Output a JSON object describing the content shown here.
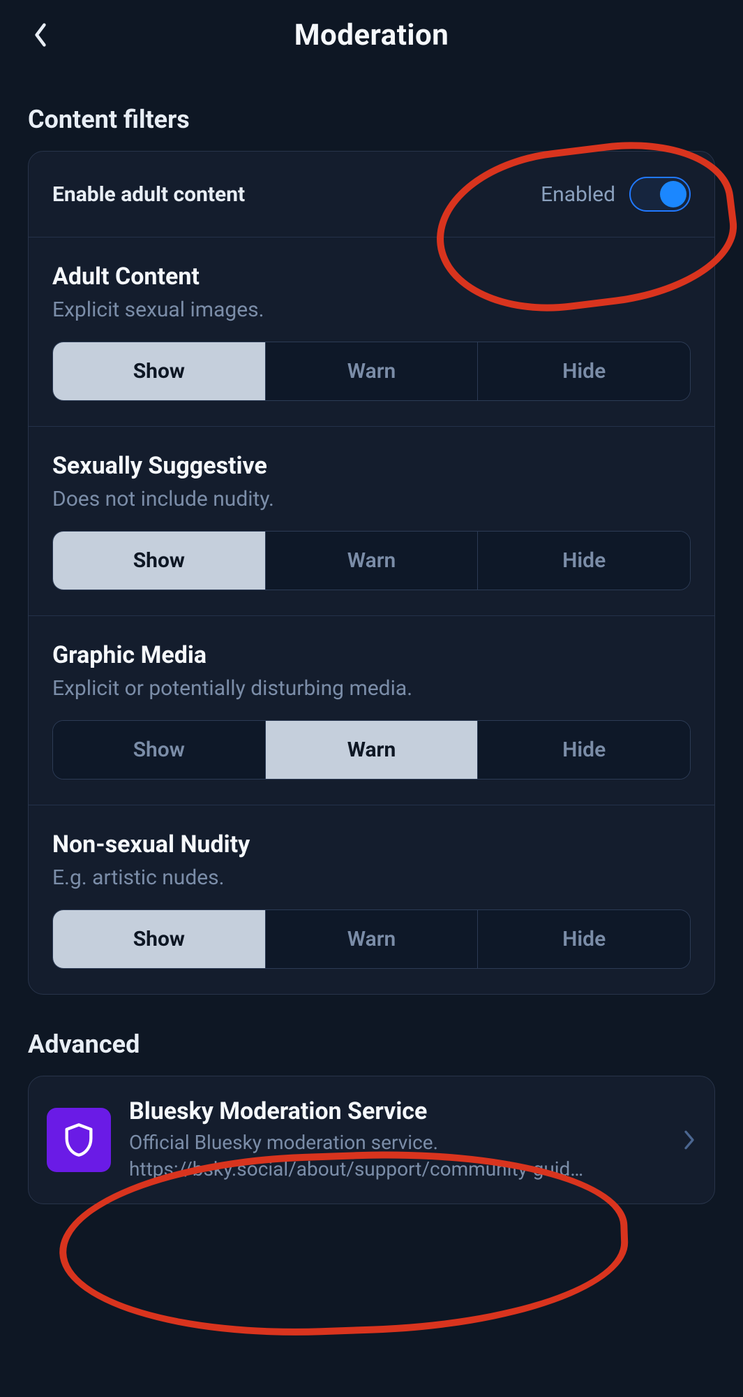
{
  "header": {
    "title": "Moderation"
  },
  "sections": {
    "content_filters_label": "Content filters",
    "advanced_label": "Advanced"
  },
  "toggle": {
    "label": "Enable adult content",
    "status_text": "Enabled",
    "value": true
  },
  "segment_labels": {
    "show": "Show",
    "warn": "Warn",
    "hide": "Hide"
  },
  "filters": [
    {
      "title": "Adult Content",
      "desc": "Explicit sexual images.",
      "selected": "show"
    },
    {
      "title": "Sexually Suggestive",
      "desc": "Does not include nudity.",
      "selected": "show"
    },
    {
      "title": "Graphic Media",
      "desc": "Explicit or potentially disturbing media.",
      "selected": "warn"
    },
    {
      "title": "Non-sexual Nudity",
      "desc": "E.g. artistic nudes.",
      "selected": "show"
    }
  ],
  "service": {
    "title": "Bluesky Moderation Service",
    "desc": "Official Bluesky moderation service. https://bsky.social/about/support/community-guid…"
  },
  "colors": {
    "accent_blue": "#1b87ff",
    "service_purple": "#6a1be6",
    "annotation_red": "#d9341e"
  }
}
